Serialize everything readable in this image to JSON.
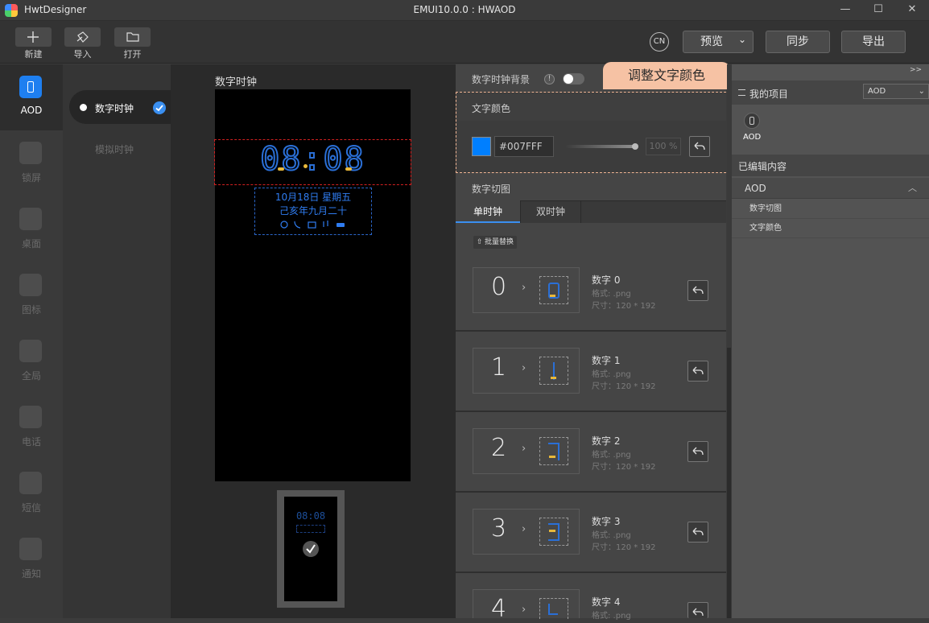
{
  "window": {
    "app_name": "HwtDesigner",
    "title": "EMUI10.0.0 : HWAOD",
    "minimize": "—",
    "maximize": "☐",
    "close": "✕"
  },
  "toolbar": {
    "new_label": "新建",
    "import_label": "导入",
    "open_label": "打开",
    "lang_badge": "CN",
    "preview_label": "预览",
    "preview_chevron": "⌄",
    "sync_label": "同步",
    "export_label": "导出"
  },
  "sidebar": {
    "items": [
      {
        "label": "AOD",
        "icon": "phone-icon",
        "active": true
      },
      {
        "label": "锁屏",
        "icon": "lock-screen-icon"
      },
      {
        "label": "桌面",
        "icon": "desktop-icon"
      },
      {
        "label": "图标",
        "icon": "grid-icon"
      },
      {
        "label": "全局",
        "icon": "gear-icon"
      },
      {
        "label": "电话",
        "icon": "phone-call-icon"
      },
      {
        "label": "短信",
        "icon": "message-icon"
      },
      {
        "label": "通知",
        "icon": "notification-icon"
      }
    ],
    "accent": "#1e7ff0"
  },
  "clock_types": {
    "digital": "数字时钟",
    "analog": "模拟时钟"
  },
  "preview": {
    "title": "数字时钟",
    "time": "08:08",
    "date_line1": "10月18日 星期五",
    "date_line2": "己亥年九月二十",
    "thumb_time": "08:08"
  },
  "editor": {
    "bg_toggle_label": "数字时钟背景",
    "bg_toggle_on": false,
    "tooltip": "调整文字颜色",
    "text_color": {
      "title": "文字颜色",
      "hex": "#007FFF",
      "opacity": "100 %"
    },
    "slices": {
      "title": "数字切图",
      "tabs": [
        "单时钟",
        "双时钟"
      ],
      "batch_replace": "批量替换",
      "digits": [
        {
          "value": "0",
          "name": "数字 0",
          "format": "格式: .png",
          "size": "尺寸：120 * 192"
        },
        {
          "value": "1",
          "name": "数字 1",
          "format": "格式: .png",
          "size": "尺寸：120 * 192"
        },
        {
          "value": "2",
          "name": "数字 2",
          "format": "格式: .png",
          "size": "尺寸：120 * 192"
        },
        {
          "value": "3",
          "name": "数字 3",
          "format": "格式: .png",
          "size": "尺寸：120 * 192"
        },
        {
          "value": "4",
          "name": "数字 4",
          "format": "格式: .png",
          "size": ""
        }
      ]
    }
  },
  "project": {
    "collapse": ">>",
    "title": "我的项目",
    "selected": "AOD",
    "name": "AOD",
    "edited_title": "已编辑内容",
    "group": "AOD",
    "edited_items": [
      "数字切图",
      "文字颜色"
    ]
  },
  "colors": {
    "digit_blue": "#2a6fd6",
    "digit_gold": "#e8b83a",
    "tooltip_bg": "#f6c2a4"
  }
}
